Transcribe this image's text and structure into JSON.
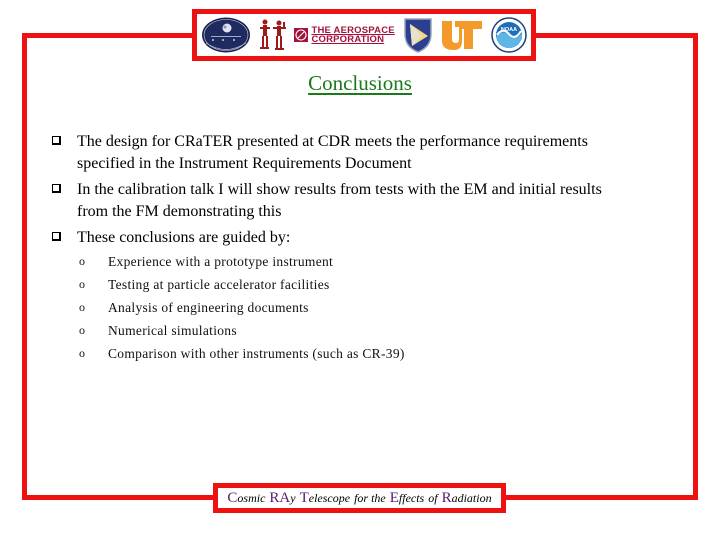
{
  "logos": [
    {
      "name": "nasa-lro-seal",
      "label": ""
    },
    {
      "name": "crater-figures-logo",
      "label": ""
    },
    {
      "name": "aerospace-corporation-logo",
      "label_line1": "THE AEROSPACE",
      "label_line2": "CORPORATION"
    },
    {
      "name": "air-force-research-lab-shield",
      "label": ""
    },
    {
      "name": "university-of-tennessee-logo",
      "label": "UT"
    },
    {
      "name": "noaa-logo",
      "label": "NOAA"
    }
  ],
  "title": "Conclusions",
  "main_bullets": [
    {
      "icon": "square-bullet-icon",
      "text": "The design for CRaTER presented at CDR meets the performance requirements specified in the Instrument Requirements Document",
      "line1": "The design for CRaTER presented at CDR meets the performance requirements",
      "line2": "specified in the Instrument Requirements Document"
    },
    {
      "icon": "square-bullet-icon",
      "text": "In the calibration talk I will show results from tests with the EM and initial results from the FM demonstrating this",
      "line1": "In the calibration talk I will show results from tests with the EM and initial results",
      "line2": "from the FM demonstrating this"
    },
    {
      "icon": "square-bullet-icon",
      "text": "These conclusions are guided by:",
      "line1": "These conclusions are guided by:"
    }
  ],
  "sub_bullets": [
    {
      "marker": "o",
      "text": "Experience with a prototype instrument"
    },
    {
      "marker": "o",
      "text": "Testing at particle accelerator facilities"
    },
    {
      "marker": "o",
      "text": "Analysis of engineering documents"
    },
    {
      "marker": "o",
      "text": "Numerical simulations"
    },
    {
      "marker": "o",
      "text": "Comparison with other instruments (such as CR-39)"
    }
  ],
  "footer": {
    "full_text": "Cosmic RAy Telescope for the Effects of Radiation",
    "parts": [
      {
        "cap": "C",
        "rest": "osmic"
      },
      {
        "cap": "RA",
        "rest": "y"
      },
      {
        "cap": "T",
        "rest": "elescope"
      },
      {
        "cap": "",
        "rest": "for the"
      },
      {
        "cap": "E",
        "rest": "ffects"
      },
      {
        "cap": "",
        "rest": "of"
      },
      {
        "cap": "R",
        "rest": "adiation"
      }
    ]
  },
  "colors": {
    "frame": "#ee1111",
    "title": "#1a7a1a",
    "footer_caps": "#5a1a6e",
    "aerospace_brand": "#a3123a",
    "ut_orange": "#f39a2b",
    "noaa_blue": "#1f6fb8"
  }
}
